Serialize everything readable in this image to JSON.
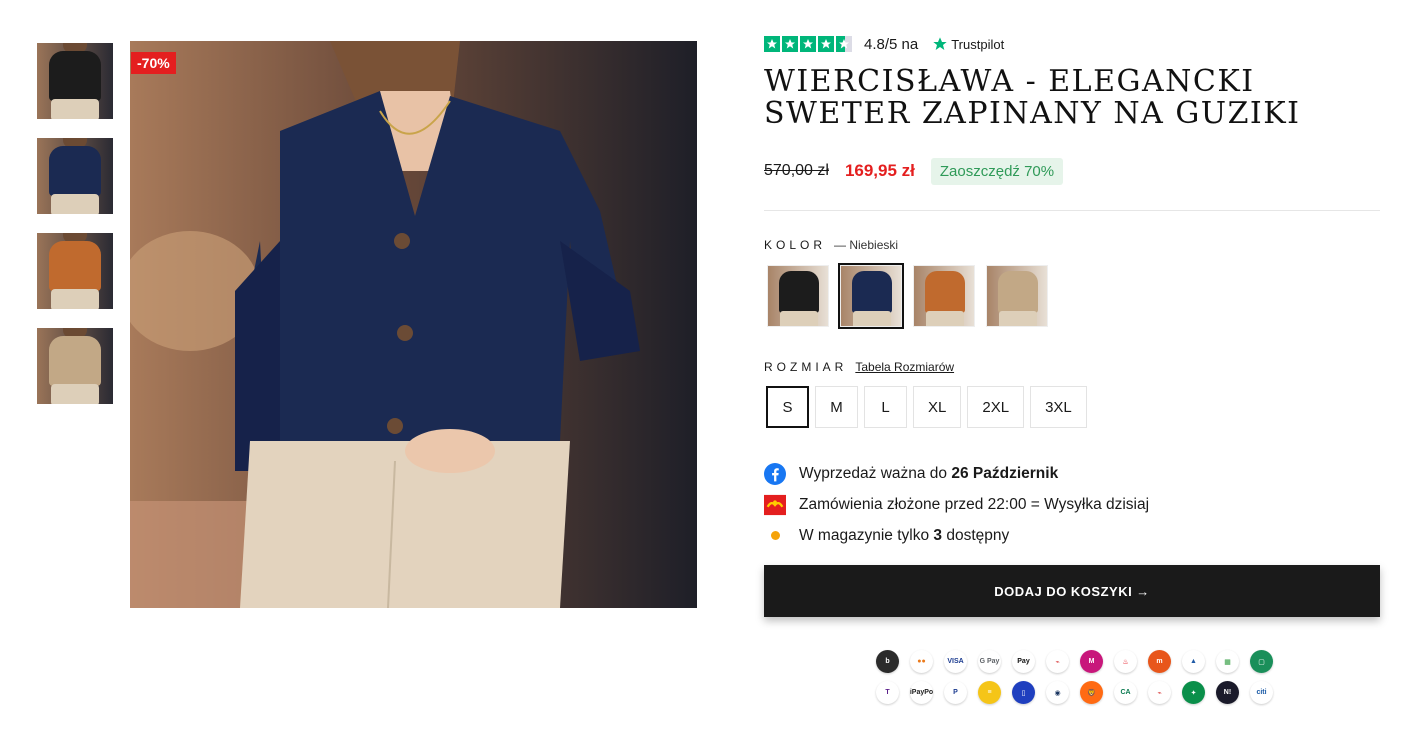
{
  "gallery": {
    "discount_badge": "-70%",
    "thumbnails": [
      {
        "name": "black",
        "color": "#1c1c1c"
      },
      {
        "name": "navy",
        "color": "#1b2a52"
      },
      {
        "name": "orange",
        "color": "#c06a2e"
      },
      {
        "name": "beige",
        "color": "#c2a886"
      }
    ],
    "active_index": 1
  },
  "rating": {
    "score_text": "4.8/5 na",
    "provider": "Trustpilot",
    "star_color": "#00b67a"
  },
  "product": {
    "title": "WIERCISŁAWA - ELEGANCKI SWETER ZAPINANY NA GUZIKI",
    "old_price": "570,00 zł",
    "new_price": "169,95 zł",
    "save_badge": "Zaoszczędź 70%"
  },
  "color_option": {
    "label": "KOLOR",
    "selected_text": "— Niebieski",
    "swatches": [
      {
        "name": "black",
        "color": "#1c1c1c"
      },
      {
        "name": "navy",
        "color": "#1b2a52"
      },
      {
        "name": "orange",
        "color": "#c06a2e"
      },
      {
        "name": "beige",
        "color": "#c2a886"
      }
    ],
    "selected_index": 1
  },
  "size_option": {
    "label": "ROZMIAR",
    "guide_link": "Tabela Rozmiarów",
    "sizes": [
      "S",
      "M",
      "L",
      "XL",
      "2XL",
      "3XL"
    ],
    "selected_index": 0
  },
  "notes": {
    "sale_prefix": "Wyprzedaż ważna do ",
    "sale_date": "26 Październik",
    "shipping": "Zamówienia złożone przed 22:00 = Wysyłka dzisiaj",
    "stock_prefix": "W magazynie tylko ",
    "stock_count": "3",
    "stock_suffix": " dostępny"
  },
  "cart": {
    "button_label": "DODAJ DO KOSZYKI →"
  },
  "payments": {
    "row1": [
      {
        "icon": "blik-icon",
        "text": "b",
        "bg": "#2b2b2b"
      },
      {
        "icon": "mastercard-icon",
        "text": "●●",
        "bg": "#ffffff",
        "fg": "#eb7a1b"
      },
      {
        "icon": "visa-icon",
        "text": "VISA",
        "bg": "#ffffff",
        "fg": "#1a3a8f"
      },
      {
        "icon": "google-pay-icon",
        "text": "G Pay",
        "bg": "#ffffff",
        "fg": "#5f6368"
      },
      {
        "icon": "apple-pay-icon",
        "text": " Pay",
        "bg": "#ffffff",
        "fg": "#111111"
      },
      {
        "icon": "bank-hand-icon",
        "text": "⌁",
        "bg": "#ffffff",
        "fg": "#d62b2b"
      },
      {
        "icon": "millennium-icon",
        "text": "M",
        "bg": "#c8177b"
      },
      {
        "icon": "santander-icon",
        "text": "♨",
        "bg": "#ffffff",
        "fg": "#e30613"
      },
      {
        "icon": "mbank-icon",
        "text": "m",
        "bg": "#e8561b"
      },
      {
        "icon": "pekao-icon",
        "text": "▲",
        "bg": "#ffffff",
        "fg": "#1f5aa6"
      },
      {
        "icon": "grid-bank-icon",
        "text": "▦",
        "bg": "#ffffff",
        "fg": "#2a9a3a"
      },
      {
        "icon": "chat-bank-icon",
        "text": "▢",
        "bg": "#1a8f5a"
      }
    ],
    "row2": [
      {
        "icon": "t-mobile-icon",
        "text": "T",
        "bg": "#ffffff",
        "fg": "#5a1f8a"
      },
      {
        "icon": "paypo-icon",
        "text": "iPayPo",
        "bg": "#ffffff",
        "fg": "#222222"
      },
      {
        "icon": "paypal-icon",
        "text": "P",
        "bg": "#ffffff",
        "fg": "#1a3a8f"
      },
      {
        "icon": "yellow-bank-icon",
        "text": "≡",
        "bg": "#f5c518"
      },
      {
        "icon": "phone-bank-icon",
        "text": "▯",
        "bg": "#1f3fbf"
      },
      {
        "icon": "pko-icon",
        "text": "◉",
        "bg": "#ffffff",
        "fg": "#1a3560"
      },
      {
        "icon": "ing-icon",
        "text": "🦁",
        "bg": "#ff6a13"
      },
      {
        "icon": "credit-agricole-icon",
        "text": "CA",
        "bg": "#ffffff",
        "fg": "#0a7a50"
      },
      {
        "icon": "poczta-icon",
        "text": "⌁",
        "bg": "#ffffff",
        "fg": "#d62b2b"
      },
      {
        "icon": "bnp-icon",
        "text": "✦",
        "bg": "#0a8f4a"
      },
      {
        "icon": "nest-bank-icon",
        "text": "N!",
        "bg": "#1a1a2a"
      },
      {
        "icon": "citi-icon",
        "text": "citi",
        "bg": "#ffffff",
        "fg": "#1a5aa6"
      }
    ]
  }
}
